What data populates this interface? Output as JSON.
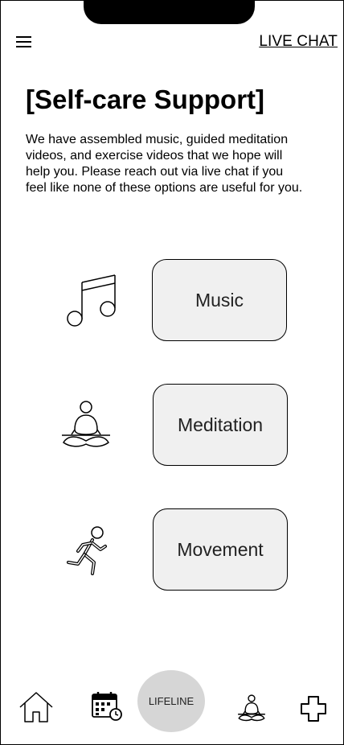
{
  "header": {
    "menu_icon": "hamburger-menu-icon",
    "live_chat_label": "LIVE CHAT"
  },
  "page": {
    "title": "[Self-care Support]",
    "description": "We have assembled music, guided meditation videos, and exercise videos that we hope will help you. Please reach out via live chat if you feel like none of these options are useful for you."
  },
  "options": [
    {
      "icon": "music-note-icon",
      "label": "Music"
    },
    {
      "icon": "meditation-icon",
      "label": "Meditation"
    },
    {
      "icon": "running-person-icon",
      "label": "Movement"
    }
  ],
  "bottom_nav": {
    "home_icon": "home-icon",
    "calendar_icon": "calendar-clock-icon",
    "lifeline_label": "LIFELINE",
    "meditation_icon": "meditation-icon",
    "medical_icon": "medical-cross-icon"
  }
}
